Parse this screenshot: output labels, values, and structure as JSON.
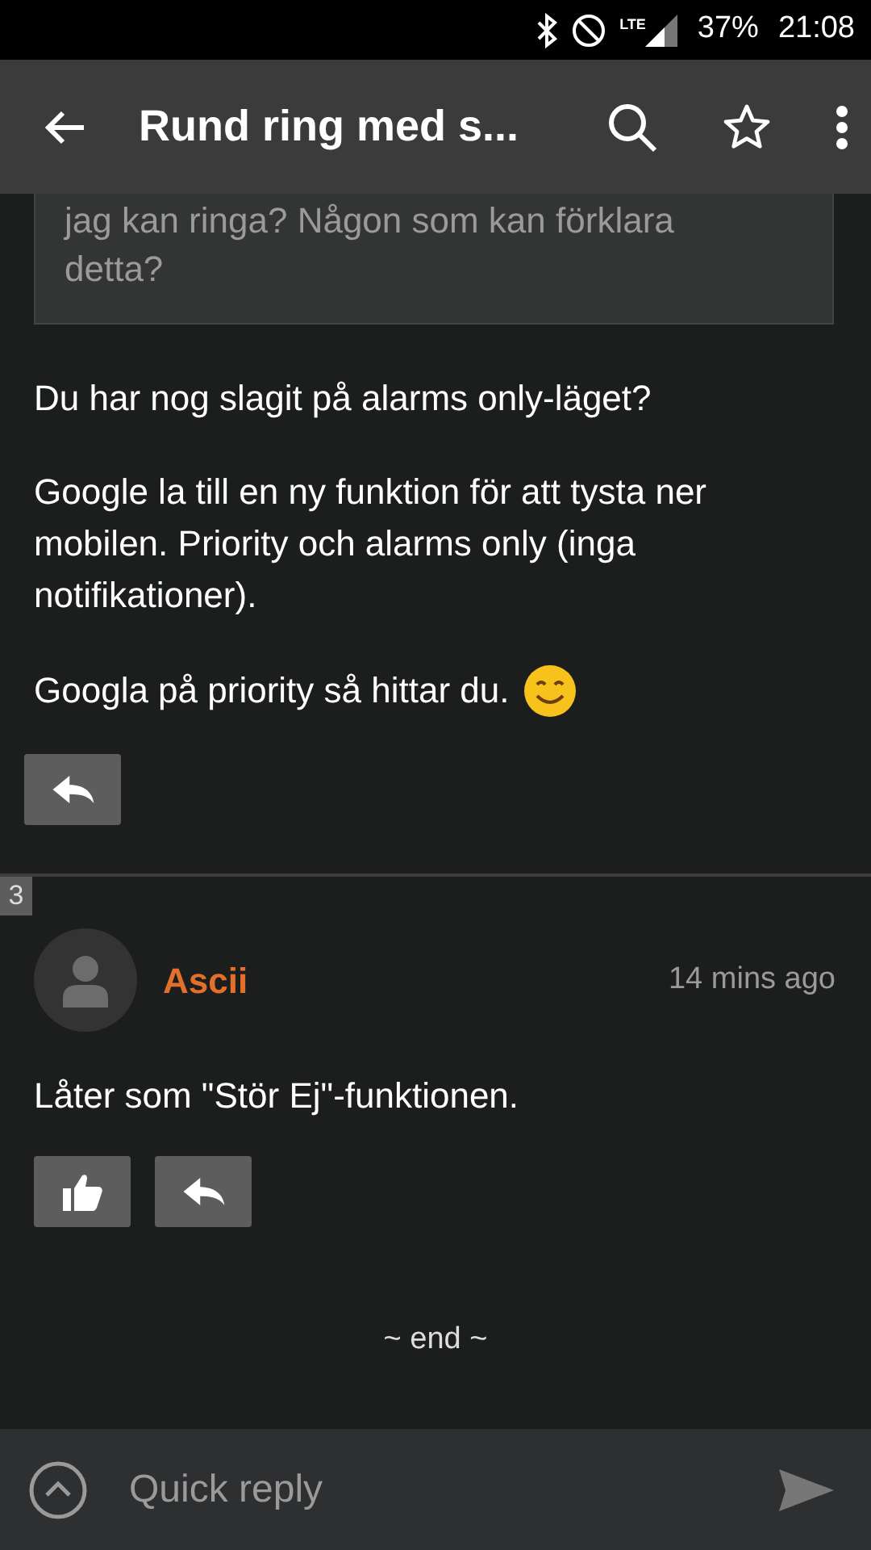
{
  "status_bar": {
    "battery": "37%",
    "time": "21:08",
    "network": "LTE"
  },
  "app_bar": {
    "title": "Rund ring med s..."
  },
  "post": {
    "quote": "jag kan ringa? Någon som kan förklara detta?",
    "paragraphs": [
      {
        "text": "Du har nog slagit på alarms only-läget?",
        "emoji": false
      },
      {
        "text": "Google la till en ny funktion för att tysta ner mobilen. Priority och alarms only (inga notifikationer).",
        "emoji": false
      },
      {
        "text": "Googla på priority så hittar du.",
        "emoji": true
      }
    ]
  },
  "comment": {
    "number": "3",
    "author": "Ascii",
    "time": "14 mins ago",
    "body": "Låter som \"Stör Ej\"-funktionen."
  },
  "end_marker": "~ end ~",
  "quick_reply": {
    "placeholder": "Quick reply"
  }
}
